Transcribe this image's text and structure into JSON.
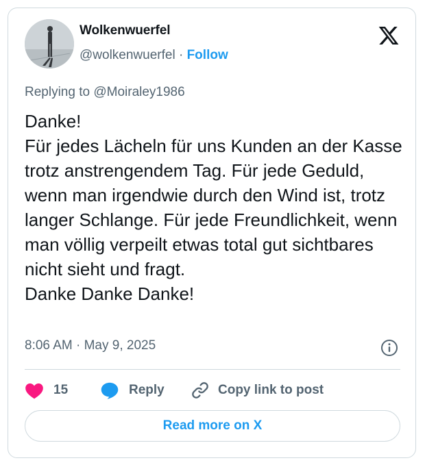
{
  "author": {
    "display_name": "Wolkenwuerfel",
    "handle": "@wolkenwuerfel",
    "separator": "·",
    "follow_label": "Follow"
  },
  "reply_context": "Replying to @Moiraley1986",
  "tweet": {
    "text": "Danke!\nFür jedes Lächeln für uns Kunden an der Kasse trotz anstrengendem Tag. Für jede Geduld, wenn man irgendwie durch den Wind ist, trotz langer Schlange. Für jede Freundlichkeit, wenn man völlig verpeilt etwas total gut sichtbares nicht sieht und fragt.\nDanke Danke Danke!",
    "timestamp": "8:06 AM · May 9, 2025"
  },
  "actions": {
    "like_count": "15",
    "reply_label": "Reply",
    "copy_label": "Copy link to post"
  },
  "read_more_label": "Read more on X",
  "colors": {
    "accent": "#1d9bf0",
    "like": "#f91880",
    "muted": "#536471",
    "border": "#cfd9de"
  },
  "icons": [
    "x-logo-icon",
    "info-icon",
    "heart-icon",
    "reply-bubble-icon",
    "link-icon"
  ]
}
